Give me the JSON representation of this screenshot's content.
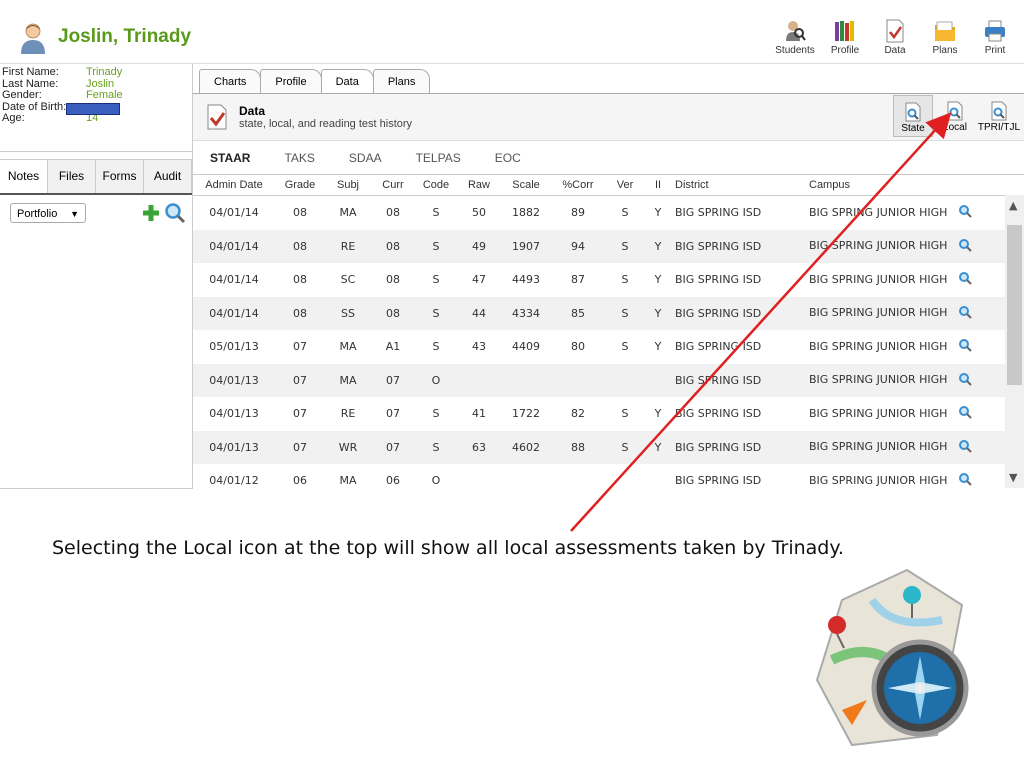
{
  "header": {
    "student_name": "Joslin, Trinady",
    "nav": [
      {
        "label": "Students",
        "icon": "students-icon"
      },
      {
        "label": "Profile",
        "icon": "profile-icon"
      },
      {
        "label": "Data",
        "icon": "data-icon"
      },
      {
        "label": "Plans",
        "icon": "plans-icon"
      },
      {
        "label": "Print",
        "icon": "print-icon"
      }
    ]
  },
  "student_info": {
    "first_name_label": "First Name:",
    "first_name": "Trinady",
    "last_name_label": "Last Name:",
    "last_name": "Joslin",
    "gender_label": "Gender:",
    "gender": "Female",
    "dob_label": "Date of Birth:",
    "age_label": "Age:",
    "age": "14"
  },
  "left_tabs": [
    "Notes",
    "Files",
    "Forms",
    "Audit"
  ],
  "portfolio": {
    "selected": "Portfolio"
  },
  "main_tabs": [
    "Charts",
    "Profile",
    "Data",
    "Plans"
  ],
  "data_section": {
    "title": "Data",
    "subtitle": "state, local, and reading test history",
    "buttons": [
      "State",
      "Local",
      "TPRI/TJL"
    ]
  },
  "sub_tabs": [
    "STAAR",
    "TAKS",
    "SDAA",
    "TELPAS",
    "EOC"
  ],
  "table": {
    "headers": [
      "Admin Date",
      "Grade",
      "Subj",
      "Curr",
      "Code",
      "Raw",
      "Scale",
      "%Corr",
      "Ver",
      "II",
      "District",
      "Campus"
    ],
    "rows": [
      [
        "04/01/14",
        "08",
        "MA",
        "08",
        "S",
        "50",
        "1882",
        "89",
        "S",
        "Y",
        "BIG SPRING ISD",
        "BIG SPRING JUNIOR HIGH"
      ],
      [
        "04/01/14",
        "08",
        "RE",
        "08",
        "S",
        "49",
        "1907",
        "94",
        "S",
        "Y",
        "BIG SPRING ISD",
        "BIG SPRING JUNIOR HIGH"
      ],
      [
        "04/01/14",
        "08",
        "SC",
        "08",
        "S",
        "47",
        "4493",
        "87",
        "S",
        "Y",
        "BIG SPRING ISD",
        "BIG SPRING JUNIOR HIGH"
      ],
      [
        "04/01/14",
        "08",
        "SS",
        "08",
        "S",
        "44",
        "4334",
        "85",
        "S",
        "Y",
        "BIG SPRING ISD",
        "BIG SPRING JUNIOR HIGH"
      ],
      [
        "05/01/13",
        "07",
        "MA",
        "A1",
        "S",
        "43",
        "4409",
        "80",
        "S",
        "Y",
        "BIG SPRING ISD",
        "BIG SPRING JUNIOR HIGH"
      ],
      [
        "04/01/13",
        "07",
        "MA",
        "07",
        "O",
        "",
        "",
        "",
        "",
        "",
        "BIG SPRING ISD",
        "BIG SPRING JUNIOR HIGH"
      ],
      [
        "04/01/13",
        "07",
        "RE",
        "07",
        "S",
        "41",
        "1722",
        "82",
        "S",
        "Y",
        "BIG SPRING ISD",
        "BIG SPRING JUNIOR HIGH"
      ],
      [
        "04/01/13",
        "07",
        "WR",
        "07",
        "S",
        "63",
        "4602",
        "88",
        "S",
        "Y",
        "BIG SPRING ISD",
        "BIG SPRING JUNIOR HIGH"
      ],
      [
        "04/01/12",
        "06",
        "MA",
        "06",
        "O",
        "",
        "",
        "",
        "",
        "",
        "BIG SPRING ISD",
        "BIG SPRING JUNIOR HIGH"
      ]
    ]
  },
  "caption": "Selecting the Local icon at the top will show all local assessments taken by Trinady."
}
